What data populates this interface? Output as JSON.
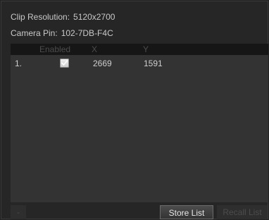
{
  "info": {
    "resolution_label": "Clip Resolution:",
    "resolution_value": "5120x2700",
    "pin_label": "Camera Pin:",
    "pin_value": "102-7DB-F4C"
  },
  "table": {
    "columns": [
      "",
      "Enabled",
      "X",
      "Y"
    ],
    "rows": [
      {
        "index": "1.",
        "enabled": true,
        "x": "2669",
        "y": "1591"
      }
    ]
  },
  "buttons": {
    "minus_label": "-",
    "store_label": "Store List",
    "recall_label": "Recall List"
  },
  "colors": {
    "panel": "#262626",
    "table_bg": "#333333",
    "header_bg": "#161616",
    "text": "#cfcfcf",
    "disabled_text": "#4c4c4c"
  },
  "icons": {
    "checkbox": "checkmark-icon"
  }
}
